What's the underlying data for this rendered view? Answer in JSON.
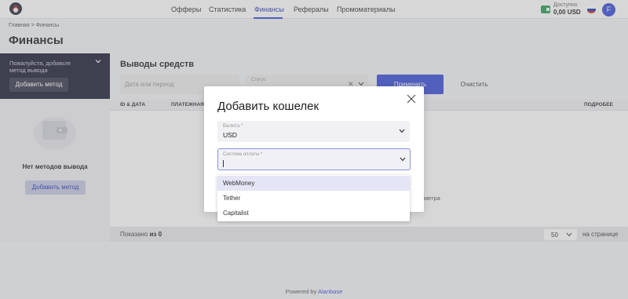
{
  "header": {
    "nav": [
      "Офферы",
      "Статистика",
      "Финансы",
      "Рефералы",
      "Промоматериалы"
    ],
    "active_nav": "Финансы",
    "balance_label": "Доступно",
    "balance_value": "0,00 USD",
    "avatar_letter": "F"
  },
  "page": {
    "breadcrumb": "Главная > Финансы",
    "title": "Финансы"
  },
  "sidebar": {
    "note": "Пожалуйста, добавьте метод вывода",
    "add_button": "Добавить метод",
    "empty_text": "Нет методов вывода",
    "empty_add_button": "Добавить метод"
  },
  "withdrawals": {
    "title": "Выводы средств",
    "date_placeholder": "Дата или период",
    "status_label": "Статус",
    "apply": "Применить",
    "clear": "Очистить",
    "columns": [
      "ID & ДАТА",
      "ПЛАТЕЖНАЯ",
      "ПОДРОБЕЕ"
    ],
    "empty_hint": "метра",
    "shown_label": "Показано",
    "shown_value": "из 0",
    "per_page_value": "50",
    "per_page_label": "на странице"
  },
  "footer": {
    "powered_by": "Powered by",
    "brand": "Alanbase"
  },
  "modal": {
    "title": "Добавить кошелек",
    "currency_label": "Валюта *",
    "currency_value": "USD",
    "payment_label": "Система оплаты *",
    "options": [
      "WebMoney",
      "Tether",
      "Capitalist"
    ],
    "highlighted_option": "WebMoney"
  },
  "colors": {
    "accent": "#3d4ed8",
    "dark_panel": "#1f2135",
    "wallet_green": "#2e9e5b"
  }
}
